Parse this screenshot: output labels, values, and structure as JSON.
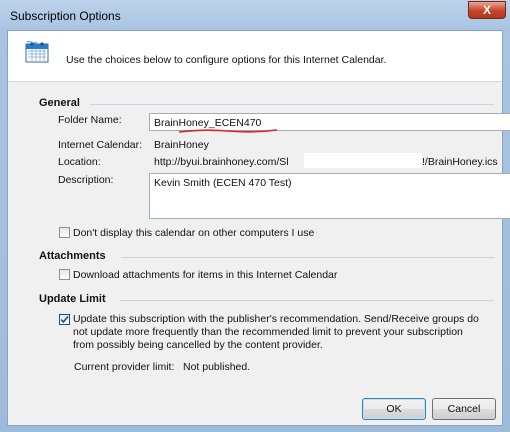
{
  "window": {
    "title": "Subscription Options",
    "close_label": "X"
  },
  "header": {
    "text": "Use the choices below to configure options for this Internet Calendar.",
    "icon": "calendar-icon"
  },
  "general": {
    "heading": "General",
    "folder_name_label": "Folder Name:",
    "folder_name_value": "BrainHoney_ECEN470",
    "internet_calendar_label": "Internet Calendar:",
    "internet_calendar_value": "BrainHoney",
    "location_label": "Location:",
    "location_value_start": "http://byui.brainhoney.com/Sl",
    "location_value_end": "!/BrainHoney.ics",
    "description_label": "Description:",
    "description_value": "Kevin Smith (ECEN 470 Test)",
    "dont_display_label": "Don't display this calendar on other computers I use",
    "dont_display_checked": false
  },
  "attachments": {
    "heading": "Attachments",
    "download_label": "Download attachments for items in this Internet Calendar",
    "download_checked": false
  },
  "update_limit": {
    "heading": "Update Limit",
    "update_line1": "Update this subscription with the publisher's recommendation. Send/Receive groups do",
    "update_line2": "not update more frequently than the recommended limit to prevent your subscription",
    "update_line3": "from possibly being cancelled by the content provider.",
    "update_checked": true,
    "provider_limit_label": "Current provider limit:",
    "provider_limit_value": "Not published."
  },
  "buttons": {
    "ok": "OK",
    "cancel": "Cancel"
  },
  "colors": {
    "title_bar": "#a9c4e3",
    "close_button": "#c5442b",
    "annotation_underline": "#d9262b"
  }
}
